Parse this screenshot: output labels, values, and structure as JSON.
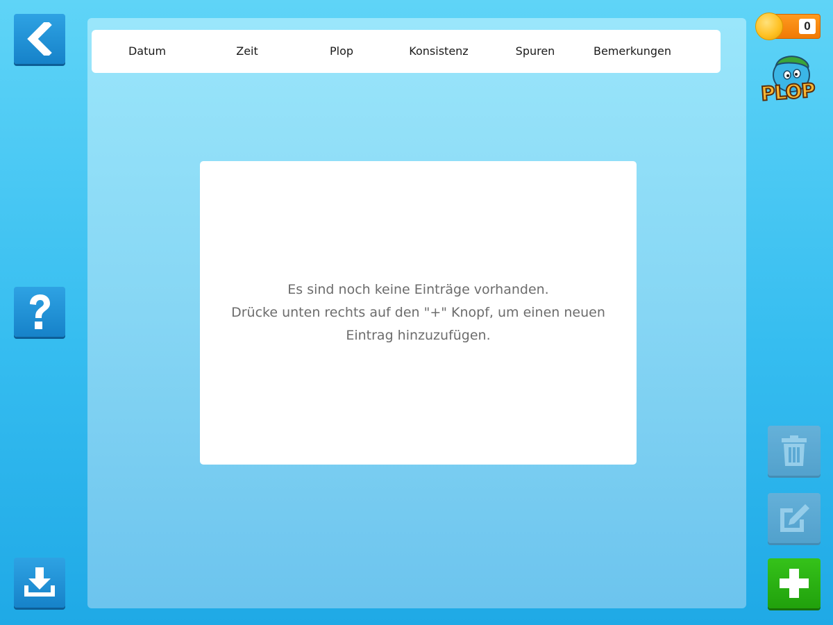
{
  "navigation": {
    "back_icon": "chevron-left-icon",
    "help_icon": "question-mark-icon",
    "download_icon": "download-icon"
  },
  "coins": {
    "count": "0",
    "icon": "coin-icon"
  },
  "logo": {
    "text": "PLOP"
  },
  "table": {
    "columns": [
      "Datum",
      "Zeit",
      "Plop",
      "Konsistenz",
      "Spuren",
      "Bemerkungen"
    ]
  },
  "empty_state": {
    "line1": "Es sind noch keine Einträge vorhanden.",
    "line2": "Drücke unten rechts auf den \"+\" Knopf, um einen neuen Eintrag hinzuzufügen."
  },
  "actions": {
    "delete_icon": "trash-icon",
    "edit_icon": "edit-icon",
    "add_icon": "plus-icon"
  },
  "colors": {
    "background": "#36bdf0",
    "button_blue": "#1e8fd5",
    "button_disabled": "#65a8d0",
    "button_green": "#2bb315",
    "coin_orange": "#f5830c"
  }
}
